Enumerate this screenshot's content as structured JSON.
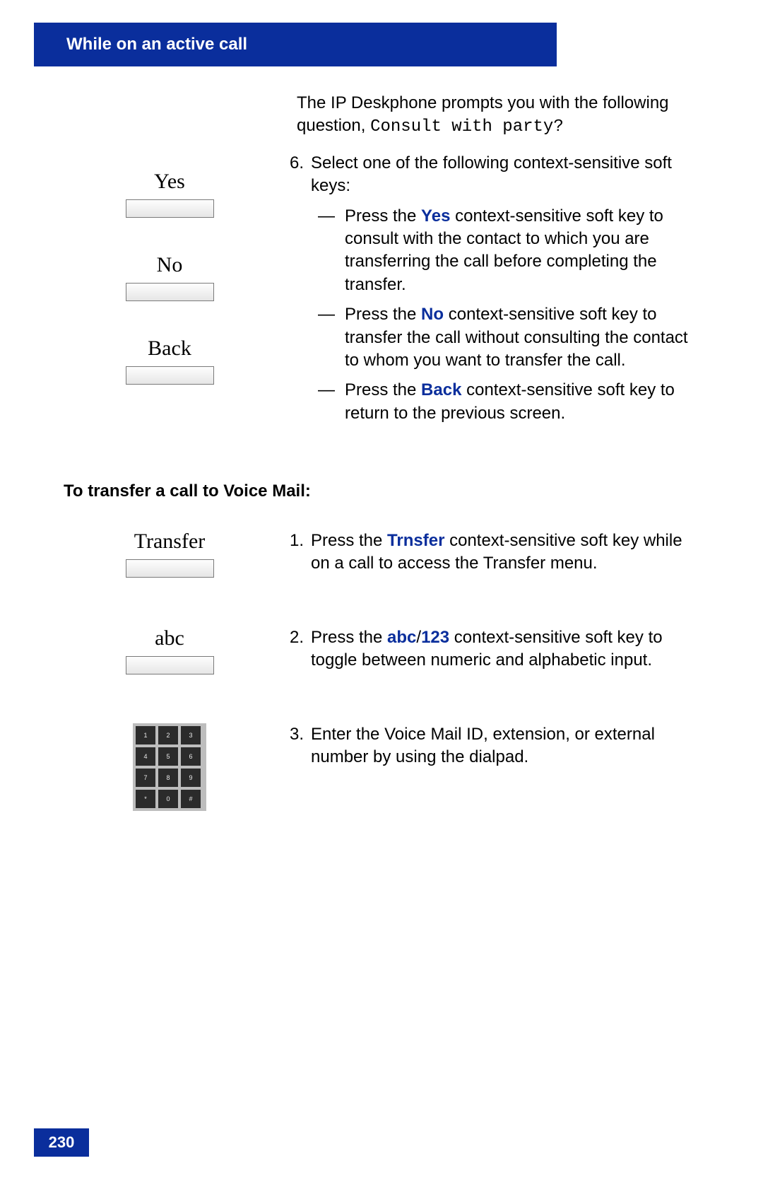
{
  "header": {
    "title": "While on an active call"
  },
  "intro": {
    "pre": "The IP Deskphone prompts you with the following question, ",
    "mono": "Consult with party?"
  },
  "step6": {
    "num": "6.",
    "lead": "Select one of the following context-sensitive soft keys:",
    "items": [
      {
        "dash": "—",
        "pre": "Press the ",
        "kw": "Yes",
        "post": " context-sensitive soft key to consult with the contact to which you are transferring the call before completing the transfer."
      },
      {
        "dash": "—",
        "pre": "Press the ",
        "kw": "No",
        "post": " context-sensitive soft key to transfer the call without consulting the contact to whom you want to transfer the call."
      },
      {
        "dash": "—",
        "pre": "Press the ",
        "kw": "Back",
        "post": " context-sensitive soft key to return to the previous screen."
      }
    ]
  },
  "softkeys1": [
    {
      "label": "Yes"
    },
    {
      "label": "No"
    },
    {
      "label": "Back"
    }
  ],
  "section2": {
    "title": "To transfer a call to Voice Mail:"
  },
  "vm_steps": [
    {
      "num": "1.",
      "left_label": "Transfer",
      "pre": "Press the ",
      "kw": "Trnsfer",
      "post": " context-sensitive soft key while on a call to access the Transfer menu."
    },
    {
      "num": "2.",
      "left_label": "abc",
      "pre": "Press the ",
      "kw": "abc",
      "mid": "/",
      "kw2": "123",
      "post": " context-sensitive soft key to toggle between numeric and alphabetic input."
    },
    {
      "num": "3.",
      "left_dialpad": true,
      "text": "Enter the Voice Mail ID, extension, or external number by using the dialpad."
    }
  ],
  "dialpad_keys": [
    "1",
    "2",
    "3",
    "4",
    "5",
    "6",
    "7",
    "8",
    "9",
    "*",
    "0",
    "#"
  ],
  "page_number": "230"
}
